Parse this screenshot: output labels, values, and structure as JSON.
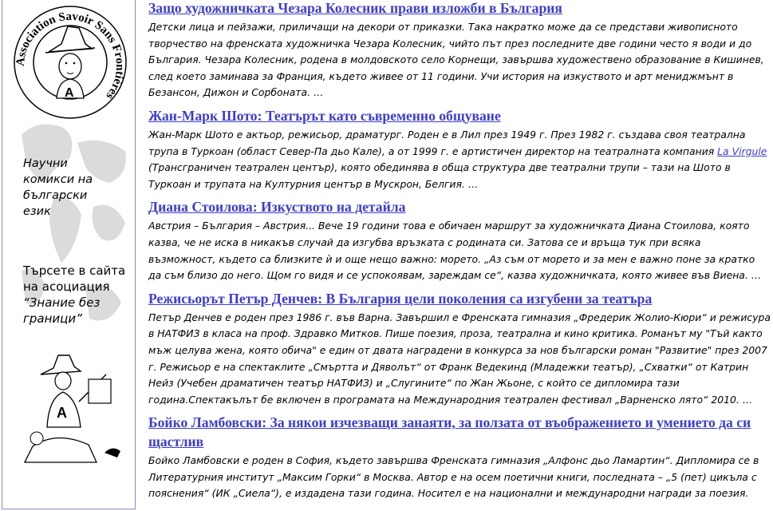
{
  "sidebar": {
    "logo_text": "Association Savoir Sans Frontières",
    "link1": "Научни комикси на български език",
    "link2_prefix": "Търсете в сайта на асоциация",
    "link2_name": "“Знание без граници”"
  },
  "articles": [
    {
      "title": "Защо художничката Чезара Колесник прави изложби в България",
      "text": "Детски лица и пейзажи, приличащи на декори от приказки. Така накратко може да се представи живописното творчество на френската художничка Чезара Колесник, чийто път през последните две години често я води и до България. Чезара Колесник, родена в молдовското село Корнещи, завършва художествено образование в Кишинев, след което заминава за Франция, където живее от 11 години. Учи история на изкуството и арт мениджмънт в Безансон, Дижон и Сорбоната.  …"
    },
    {
      "title": "Жан-Марк Шото: Театърът като съвременно общуване",
      "text_before": "Жан-Марк Шото е актьор, режисьор, драматург. Роден е в Лил през 1949 г. През 1982 г. създава своя театрална трупа в Туркоан (област Север-Па дьо Кале), а от 1999 г. е артистичен директор на театралната компания ",
      "link": "La Virgule",
      "text_after": " (Трансграничен театрален център), която обединява в обща структура две театрални трупи – тази на Шото в Туркоан и трупата на Културния център в Мускрон, Белгия. …"
    },
    {
      "title": "Диана Стоилова: Изкуството на детайла",
      "text": "Австрия – България – Австрия... Вече 19 години това е обичаен маршрут за художничката Диана Стоилова, която казва, че не иска в никакъв случай да изгубва връзката с родината си. Затова се и връща тук при всяка възможност, където са близките ѝ и още нещо важно: морето. „Аз съм от морето и за мен е важно поне за кратко да съм близо до него. Щом го видя и се успокоявам, зареждам се“, казва художничката, която живее във Виена.  …"
    },
    {
      "title": "Режисьорът Петър Денчев: В България цели поколения са изгубени за театъра",
      "text": "Петър Денчев е роден през 1986 г. във Варна. Завършил е Френската гимназия „Фредерик Жолио-Кюри“ и режисура в НАТФИЗ в класа на проф. Здравко Митков. Пише поезия, проза, театрална и кино критика. Романът му \"Тъй както мъж целува жена, която обича\" е един от двата наградени в конкурса за нов български роман \"Развитие\" през 2007 г. Режисьор е на спектаклите „Смъртта и Дяволът“ от Франк Ведекинд (Младежки театър),  „Схватки“ от Катрин Нейз (Учебен драматичен театър НАТФИЗ) и „Слугините“ по Жан Жьоне, с който се дипломира тази година.Спектакълът бе включен в програмата на Международния театрален фестивал „Варненско лято“ 2010. …"
    },
    {
      "title": "Бойко Ламбовски: За някои изчезващи занаяти, за ползата от въображението и умението да си щастлив",
      "text": "Бойко Ламбовски е роден в София, където завършва Френската гимназия „Алфонс дьо Ламартин“. Дипломира се в Литературния институт „Максим Горки“ в Москва. Автор е на осем поетични книги, последната – „5 (пет) цикъла с пояснения“ (ИК „Сиела“), е издадена тази година. Носител е на национални и международни награди за поезия."
    }
  ]
}
